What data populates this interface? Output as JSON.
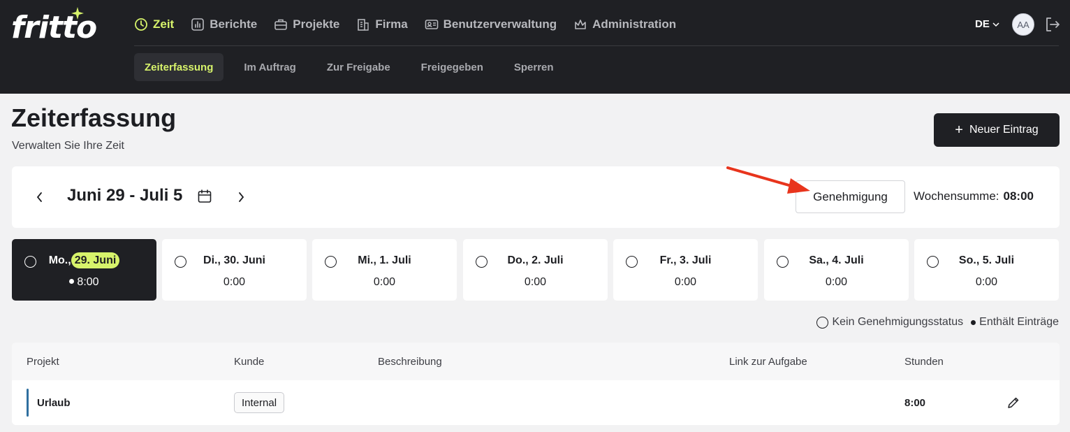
{
  "brand": {
    "logo_text": "fritto",
    "accent_color": "#d7f36b",
    "dark_color": "#1f2024"
  },
  "main_nav": [
    {
      "label": "Zeit",
      "icon": "clock-icon",
      "active": true
    },
    {
      "label": "Berichte",
      "icon": "report-icon"
    },
    {
      "label": "Projekte",
      "icon": "briefcase-icon"
    },
    {
      "label": "Firma",
      "icon": "building-icon"
    },
    {
      "label": "Benutzerverwaltung",
      "icon": "id-card-icon"
    },
    {
      "label": "Administration",
      "icon": "crown-icon"
    }
  ],
  "sub_nav": [
    {
      "label": "Zeiterfassung",
      "active": true
    },
    {
      "label": "Im Auftrag"
    },
    {
      "label": "Zur Freigabe"
    },
    {
      "label": "Freigegeben"
    },
    {
      "label": "Sperren"
    }
  ],
  "header_right": {
    "language": "DE",
    "avatar_initials": "AA",
    "logout_icon": "logout-icon"
  },
  "page": {
    "title": "Zeiterfassung",
    "subtitle": "Verwalten Sie Ihre Zeit",
    "new_entry_label": "Neuer Eintrag"
  },
  "week": {
    "label": "Juni 29 - Juli 5",
    "approval_label": "Genehmigung",
    "sum_label": "Wochensumme:",
    "sum_value": "08:00"
  },
  "days": [
    {
      "prefix": "Mo.,",
      "date": "29. Juni",
      "hours": "8:00",
      "has_entries": true,
      "active": true
    },
    {
      "prefix": "Di.,",
      "date": "30. Juni",
      "hours": "0:00"
    },
    {
      "prefix": "Mi.,",
      "date": "1. Juli",
      "hours": "0:00"
    },
    {
      "prefix": "Do.,",
      "date": "2. Juli",
      "hours": "0:00"
    },
    {
      "prefix": "Fr.,",
      "date": "3. Juli",
      "hours": "0:00"
    },
    {
      "prefix": "Sa.,",
      "date": "4. Juli",
      "hours": "0:00"
    },
    {
      "prefix": "So.,",
      "date": "5. Juli",
      "hours": "0:00"
    }
  ],
  "legend": {
    "no_status": "Kein Genehmigungsstatus",
    "has_entries": "Enthält Einträge"
  },
  "table": {
    "columns": [
      "Projekt",
      "Kunde",
      "Beschreibung",
      "Link zur Aufgabe",
      "Stunden"
    ],
    "rows": [
      {
        "project": "Urlaub",
        "customer": "Internal",
        "description": "",
        "task_link": "",
        "hours": "8:00",
        "color": "#2f6f9f"
      }
    ]
  }
}
